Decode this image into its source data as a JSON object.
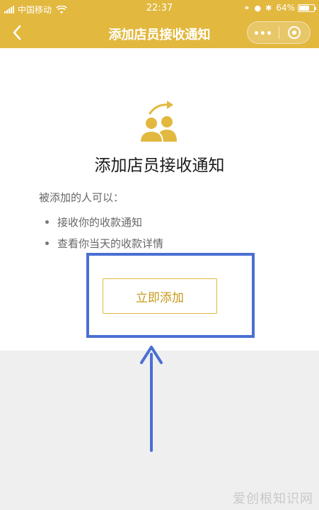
{
  "status_bar": {
    "carrier": "中国移动",
    "time": "22:37",
    "battery": "64%"
  },
  "nav": {
    "title": "添加店员接收通知"
  },
  "page": {
    "heading": "添加店员接收通知",
    "intro": "被添加的人可以：",
    "permissions": [
      "接收你的收款通知",
      "查看你当天的收款详情"
    ],
    "add_button_label": "立即添加"
  },
  "colors": {
    "brand": "#e2b83f",
    "annotation": "#4a6fd4"
  },
  "watermark": "爱创根知识网"
}
